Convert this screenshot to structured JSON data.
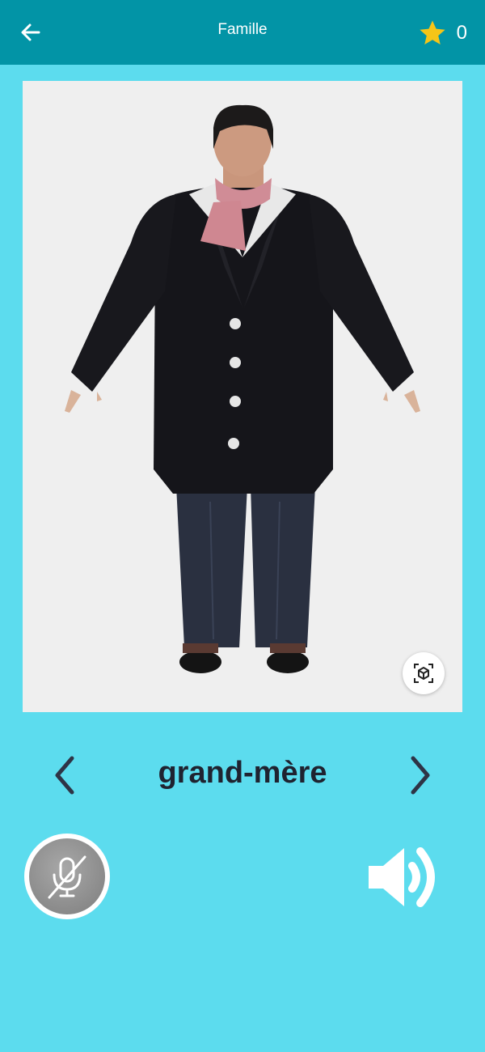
{
  "header": {
    "title": "Famille",
    "star_count": "0"
  },
  "lesson": {
    "word": "grand-mère"
  },
  "icons": {
    "back": "arrow-left-icon",
    "star": "star-icon",
    "ar": "ar-cube-icon",
    "prev": "chevron-left-icon",
    "next": "chevron-right-icon",
    "mic": "microphone-off-icon",
    "speaker": "speaker-icon"
  },
  "colors": {
    "app_bar": "#0294a6",
    "background": "#5cdcee",
    "viewer_background": "#efefef",
    "star": "#f5c518",
    "word_text": "#1f2330"
  }
}
